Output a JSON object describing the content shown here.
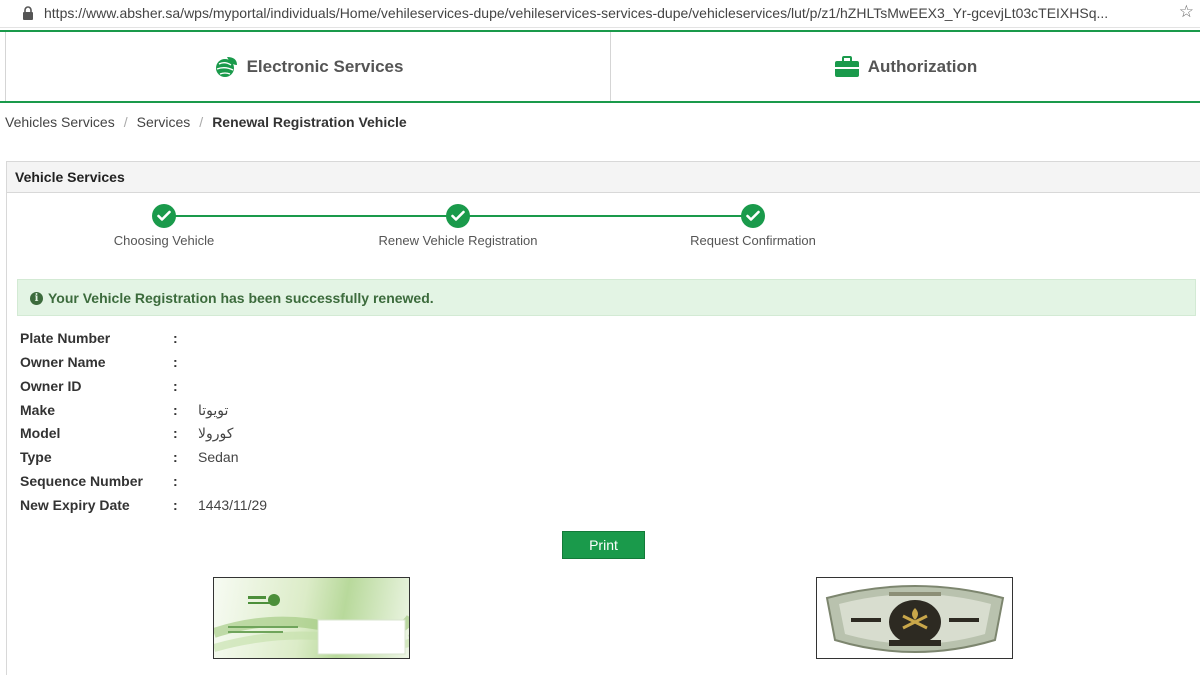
{
  "browser": {
    "url": "https://www.absher.sa/wps/myportal/individuals/Home/vehileservices-dupe/vehileservices-services-dupe/vehicleservices/lut/p/z1/hZHLTsMwEEX3_Yr-gcevjLt03cTEIXHSq..."
  },
  "tabs": [
    {
      "label": "Electronic Services",
      "icon": "globe-leaf-icon"
    },
    {
      "label": "Authorization",
      "icon": "briefcase-icon"
    }
  ],
  "breadcrumb": {
    "items": [
      "Vehicles Services",
      "Services"
    ],
    "current": "Renewal Registration Vehicle"
  },
  "panel": {
    "title": "Vehicle Services"
  },
  "steps": [
    {
      "label": "Choosing Vehicle",
      "status": "complete"
    },
    {
      "label": "Renew Vehicle Registration",
      "status": "complete"
    },
    {
      "label": "Request Confirmation",
      "status": "complete"
    }
  ],
  "alert": {
    "message": "Your Vehicle Registration has been successfully renewed."
  },
  "details": [
    {
      "label": "Plate Number",
      "value": ""
    },
    {
      "label": "Owner Name",
      "value": ""
    },
    {
      "label": "Owner ID",
      "value": ""
    },
    {
      "label": "Make",
      "value": "تويوتا"
    },
    {
      "label": "Model",
      "value": "كورولا"
    },
    {
      "label": "Type",
      "value": "Sedan"
    },
    {
      "label": "Sequence Number",
      "value": ""
    },
    {
      "label": "New Expiry Date",
      "value": "1443/11/29"
    }
  ],
  "print_label": "Print",
  "colors": {
    "brand_green": "#1a9a4b",
    "alert_bg": "#e3f4e4",
    "alert_text": "#3c6b3c"
  }
}
